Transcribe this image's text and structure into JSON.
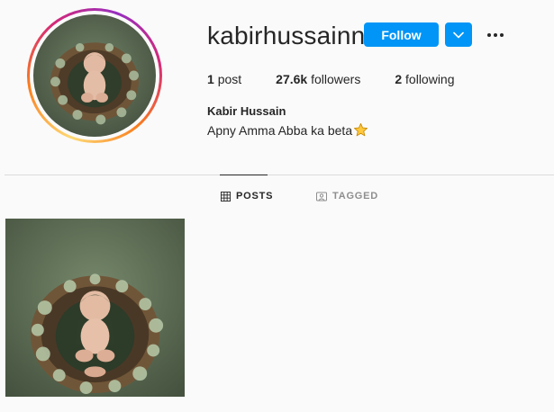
{
  "profile": {
    "username": "kabirhussainnn",
    "full_name": "Kabir Hussain",
    "bio": "Apny Amma Abba ka beta",
    "bio_emoji": "star",
    "follow_label": "Follow",
    "stats": [
      {
        "value": "1",
        "label": "post"
      },
      {
        "value": "27.6k",
        "label": "followers"
      },
      {
        "value": "2",
        "label": "following"
      }
    ]
  },
  "tabs": [
    {
      "label": "POSTS",
      "icon": "grid-icon",
      "active": true
    },
    {
      "label": "TAGGED",
      "icon": "tag-icon",
      "active": false
    }
  ],
  "posts": [
    {
      "subject": "newborn baby in nest wreath",
      "icon": "photo"
    }
  ],
  "colors": {
    "accent": "#0095f6",
    "text": "#262626",
    "muted": "#8e8e8e",
    "background": "#fafafa",
    "photo_background": "#5f6f58"
  }
}
